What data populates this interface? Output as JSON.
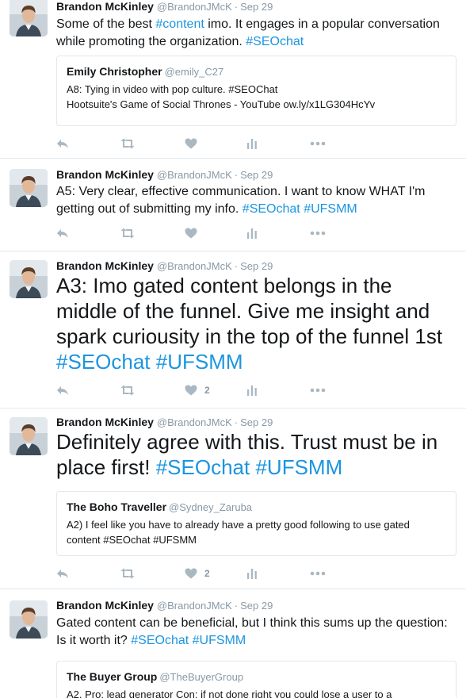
{
  "tweets": [
    {
      "fullname": "Brandon McKinley",
      "username": "@BrandonJMcK",
      "dot": "·",
      "time": "Sep 29",
      "text_parts": [
        {
          "t": "Some of the best ",
          "tag": false
        },
        {
          "t": "#content",
          "tag": true
        },
        {
          "t": " imo. It engages in a popular conversation while promoting the organization. ",
          "tag": false
        },
        {
          "t": "#SEOchat",
          "tag": true
        }
      ],
      "quote": {
        "name": "Emily Christopher",
        "user": "@emily_C27",
        "line1": "A8: Tying in video with pop culture. #SEOChat",
        "line2": "Hootsuite's Game of Social Thrones - YouTube ow.ly/x1LG304HcYv"
      },
      "likes": ""
    },
    {
      "fullname": "Brandon McKinley",
      "username": "@BrandonJMcK",
      "dot": "·",
      "time": "Sep 29",
      "text_parts": [
        {
          "t": "A5: Very clear, effective communication. I want to know WHAT I'm getting out of submitting my info. ",
          "tag": false
        },
        {
          "t": "#SEOchat",
          "tag": true
        },
        {
          "t": " ",
          "tag": false
        },
        {
          "t": "#UFSMM",
          "tag": true
        }
      ],
      "likes": ""
    },
    {
      "fullname": "Brandon McKinley",
      "username": "@BrandonJMcK",
      "dot": "·",
      "time": "Sep 29",
      "text_parts": [
        {
          "t": "A3: Imo gated content belongs in the middle of the funnel. Give me insight and spark curiousity in the top of the funnel 1st ",
          "tag": false
        },
        {
          "t": "#SEOchat",
          "tag": true
        },
        {
          "t": " ",
          "tag": false
        },
        {
          "t": "#UFSMM",
          "tag": true
        }
      ],
      "likes": "2"
    },
    {
      "fullname": "Brandon McKinley",
      "username": "@BrandonJMcK",
      "dot": "·",
      "time": "Sep 29",
      "text_parts": [
        {
          "t": "Definitely agree with this. Trust must be in place first! ",
          "tag": false
        },
        {
          "t": "#SEOchat",
          "tag": true
        },
        {
          "t": " ",
          "tag": false
        },
        {
          "t": "#UFSMM",
          "tag": true
        }
      ],
      "quote": {
        "name": "The Boho Traveller",
        "user": "@Sydney_Zaruba",
        "line1": "A2) I feel like you have to already have a pretty good following to use gated content #SEOchat #UFSMM",
        "line2": ""
      },
      "likes": "2"
    },
    {
      "fullname": "Brandon McKinley",
      "username": "@BrandonJMcK",
      "dot": "·",
      "time": "Sep 29",
      "text_parts": [
        {
          "t": "Gated content can be beneficial, but I think this sums up the question: Is it worth it? ",
          "tag": false
        },
        {
          "t": "#SEOchat",
          "tag": true
        },
        {
          "t": " ",
          "tag": false
        },
        {
          "t": "#UFSMM",
          "tag": true
        }
      ],
      "quote": {
        "name": "The Buyer Group",
        "user": "@TheBuyerGroup",
        "line1": "A2. Pro: lead generator Con: if not done right you could lose a user to a",
        "line2": ""
      },
      "likes": ""
    }
  ],
  "icons": {
    "reply": "reply-icon",
    "retweet": "retweet-icon",
    "like": "heart-icon",
    "analytics": "analytics-icon",
    "more": "more-icon"
  },
  "colors": {
    "hashtag": "#1b95e0",
    "muted": "#8899a6",
    "icon": "#aab8c2",
    "divider": "#e1e8ed"
  }
}
